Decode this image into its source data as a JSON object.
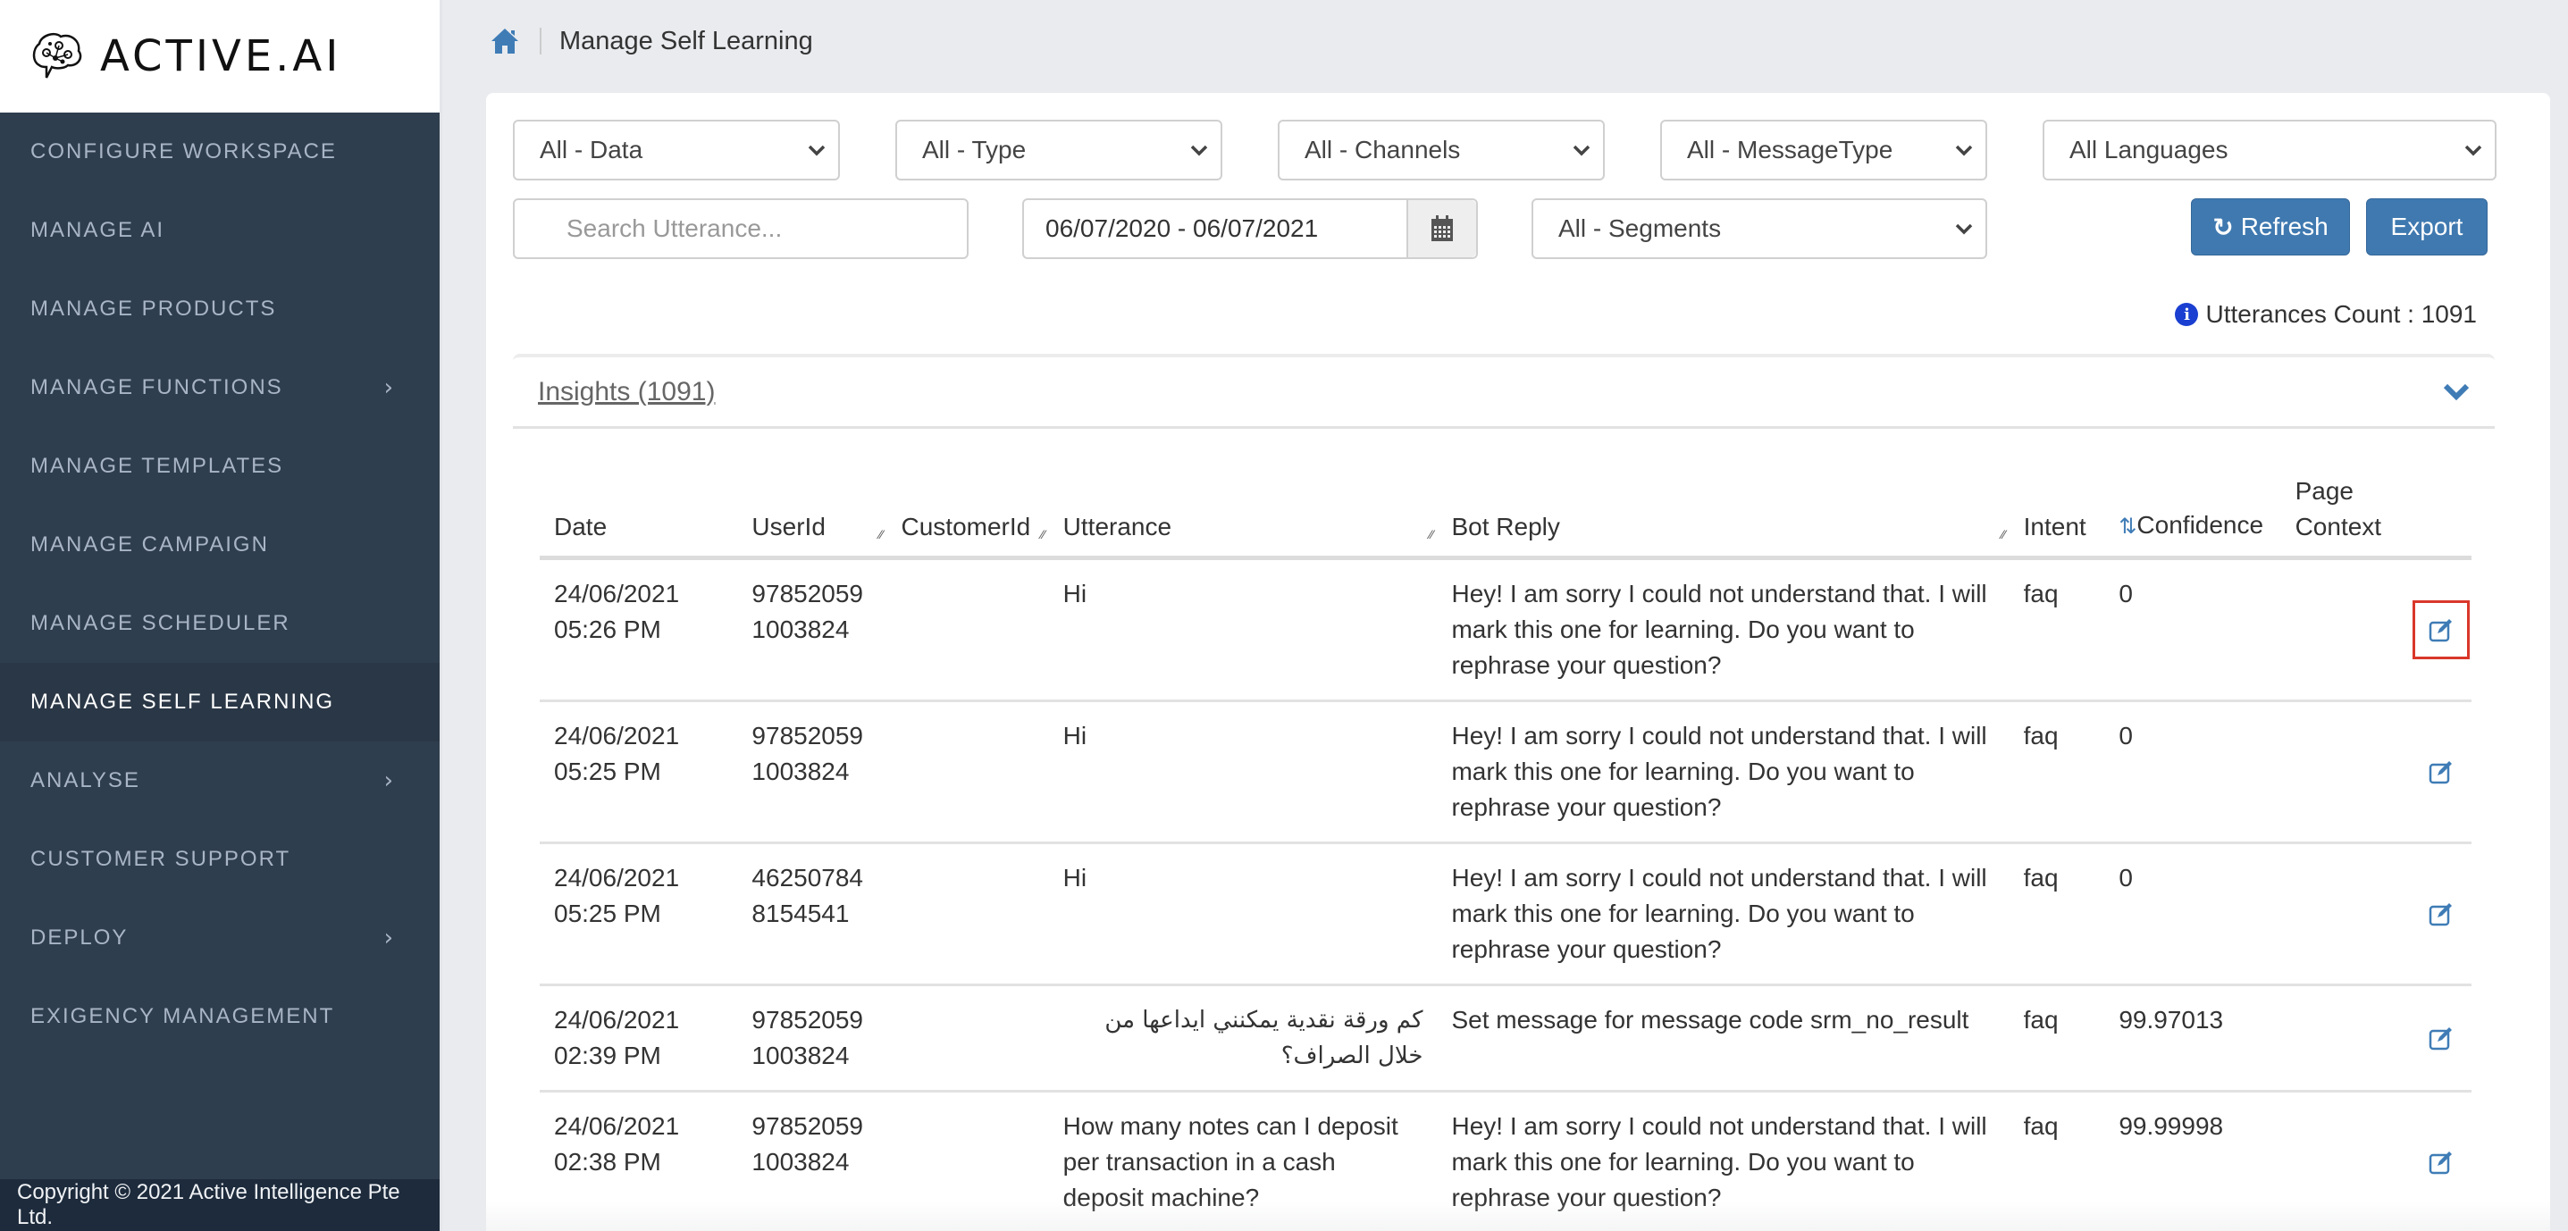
{
  "brand": {
    "name": "ACTIVE.AI",
    "logo_icon": "brain-circuit-icon"
  },
  "sidebar": {
    "items": [
      {
        "label": "CONFIGURE WORKSPACE",
        "has_submenu": false,
        "active": false
      },
      {
        "label": "MANAGE AI",
        "has_submenu": false,
        "active": false
      },
      {
        "label": "MANAGE PRODUCTS",
        "has_submenu": false,
        "active": false
      },
      {
        "label": "MANAGE FUNCTIONS",
        "has_submenu": true,
        "active": false
      },
      {
        "label": "MANAGE TEMPLATES",
        "has_submenu": false,
        "active": false
      },
      {
        "label": "MANAGE CAMPAIGN",
        "has_submenu": false,
        "active": false
      },
      {
        "label": "MANAGE SCHEDULER",
        "has_submenu": false,
        "active": false
      },
      {
        "label": "MANAGE SELF LEARNING",
        "has_submenu": false,
        "active": true
      },
      {
        "label": "ANALYSE",
        "has_submenu": true,
        "active": false
      },
      {
        "label": "CUSTOMER SUPPORT",
        "has_submenu": false,
        "active": false
      },
      {
        "label": "DEPLOY",
        "has_submenu": true,
        "active": false
      },
      {
        "label": "EXIGENCY MANAGEMENT",
        "has_submenu": false,
        "active": false
      }
    ],
    "chevron_glyph": "›",
    "copyright": "Copyright © 2021 Active Intelligence Pte Ltd."
  },
  "breadcrumb": {
    "home_icon": "home-icon",
    "title": "Manage Self Learning"
  },
  "filters": {
    "data": "All - Data",
    "type": "All - Type",
    "channels": "All - Channels",
    "message_type": "All - MessageType",
    "languages": "All Languages",
    "search_placeholder": "Search Utterance...",
    "search_value": "",
    "date_range": "06/07/2020 - 06/07/2021",
    "segments": "All - Segments"
  },
  "actions": {
    "refresh_label": "Refresh",
    "refresh_glyph": "↻",
    "export_label": "Export"
  },
  "summary": {
    "info_glyph": "i",
    "count_label": "Utterances Count : 1091"
  },
  "insights": {
    "title": "Insights (1091)",
    "columns": {
      "date": "Date",
      "user_id": "UserId",
      "customer_id": "CustomerId",
      "utterance": "Utterance",
      "bot_reply": "Bot Reply",
      "intent": "Intent",
      "confidence": "Confidence",
      "page_context": "Page Context"
    },
    "sort_glyph": "⇅",
    "resize_glyph": "⁄⁄",
    "rows": [
      {
        "date": "24/06/2021",
        "time": "05:26 PM",
        "user_id_1": "97852059",
        "user_id_2": "1003824",
        "customer_id": "",
        "utterance": "Hi",
        "bot_reply": "Hey! I am sorry I could not understand that. I will mark this one for learning. Do you want to rephrase your question?",
        "intent": "faq",
        "confidence": "0",
        "page_context": "",
        "highlighted": true
      },
      {
        "date": "24/06/2021",
        "time": "05:25 PM",
        "user_id_1": "97852059",
        "user_id_2": "1003824",
        "customer_id": "",
        "utterance": "Hi",
        "bot_reply": "Hey! I am sorry I could not understand that. I will mark this one for learning. Do you want to rephrase your question?",
        "intent": "faq",
        "confidence": "0",
        "page_context": "",
        "highlighted": false
      },
      {
        "date": "24/06/2021",
        "time": "05:25 PM",
        "user_id_1": "46250784",
        "user_id_2": "8154541",
        "customer_id": "",
        "utterance": "Hi",
        "bot_reply": "Hey! I am sorry I could not understand that. I will mark this one for learning. Do you want to rephrase your question?",
        "intent": "faq",
        "confidence": "0",
        "page_context": "",
        "highlighted": false
      },
      {
        "date": "24/06/2021",
        "time": "02:39 PM",
        "user_id_1": "97852059",
        "user_id_2": "1003824",
        "customer_id": "",
        "utterance": "كم ورقة نقدية يمكنني ايداعها من خلال الصراف؟",
        "utterance_rtl": true,
        "bot_reply": "Set message for message code srm_no_result",
        "intent": "faq",
        "confidence": "99.97013",
        "page_context": "",
        "highlighted": false
      },
      {
        "date": "24/06/2021",
        "time": "02:38 PM",
        "user_id_1": "97852059",
        "user_id_2": "1003824",
        "customer_id": "",
        "utterance": "How many notes can I deposit per transaction in a cash deposit machine?",
        "bot_reply": "Hey! I am sorry I could not understand that. I will mark this one for learning. Do you want to rephrase your question?",
        "intent": "faq",
        "confidence": "99.99998",
        "page_context": "",
        "highlighted": false
      }
    ]
  },
  "colors": {
    "sidebar_bg": "#2f3e4e",
    "accent": "#3f79b0",
    "highlight": "#d9372a",
    "info": "#1a3fd1"
  }
}
